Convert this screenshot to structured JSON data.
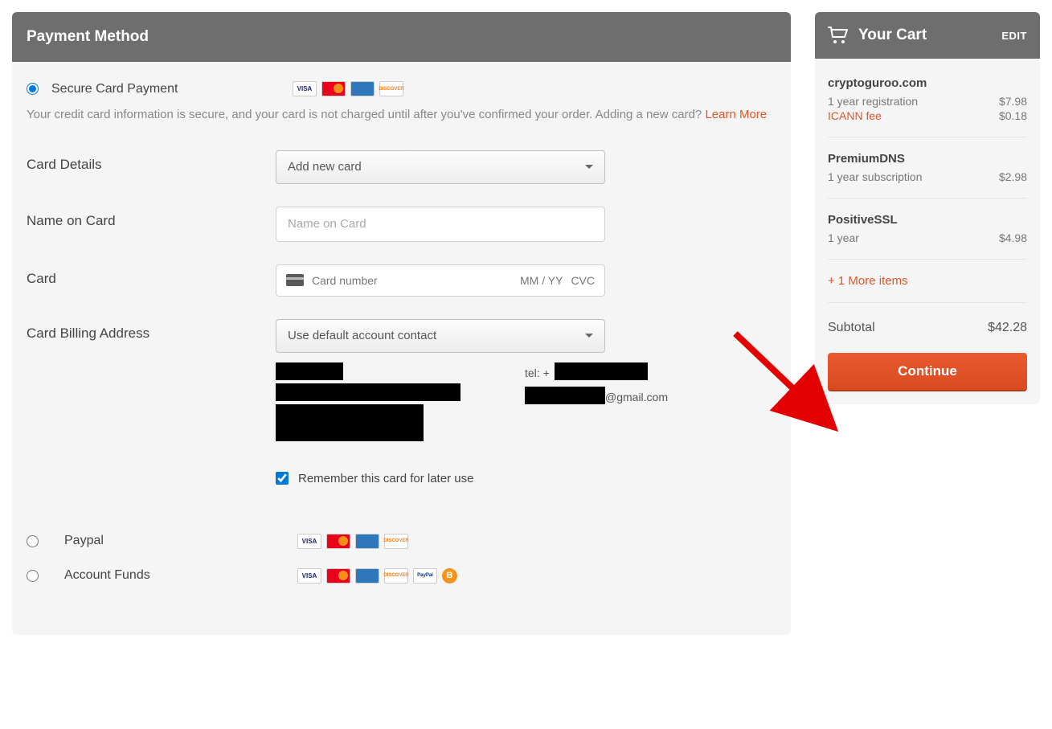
{
  "main": {
    "title": "Payment Method",
    "secure_card_label": "Secure Card Payment",
    "info_text": "Your credit card information is secure, and your card is not charged until after you've confirmed your order. Adding a new card? ",
    "learn_more": "Learn More",
    "labels": {
      "card_details": "Card Details",
      "name_on_card": "Name on Card",
      "card": "Card",
      "billing_address": "Card Billing Address"
    },
    "card_details_select": "Add new card",
    "name_placeholder": "Name on Card",
    "card_number_placeholder": "Card number",
    "card_exp_placeholder": "MM / YY",
    "card_cvc_placeholder": "CVC",
    "billing_select": "Use default account contact",
    "tel_prefix": "tel: +",
    "email_suffix": "@gmail.com",
    "remember_label": "Remember this card for later use",
    "paypal_label": "Paypal",
    "funds_label": "Account Funds"
  },
  "cart": {
    "title": "Your Cart",
    "edit": "EDIT",
    "items": [
      {
        "name": "cryptoguroo.com",
        "desc": "1 year registration",
        "price": "$7.98",
        "fee_label": "ICANN fee",
        "fee_price": "$0.18"
      },
      {
        "name": "PremiumDNS",
        "desc": "1 year subscription",
        "price": "$2.98"
      },
      {
        "name": "PositiveSSL",
        "desc": "1 year",
        "price": "$4.98"
      }
    ],
    "more_items": "+ 1 More items",
    "subtotal_label": "Subtotal",
    "subtotal_value": "$42.28",
    "continue": "Continue"
  },
  "icons": {
    "visa": "VISA",
    "disc": "DISCOVER",
    "paypal": "PayPal",
    "btc": "B"
  }
}
